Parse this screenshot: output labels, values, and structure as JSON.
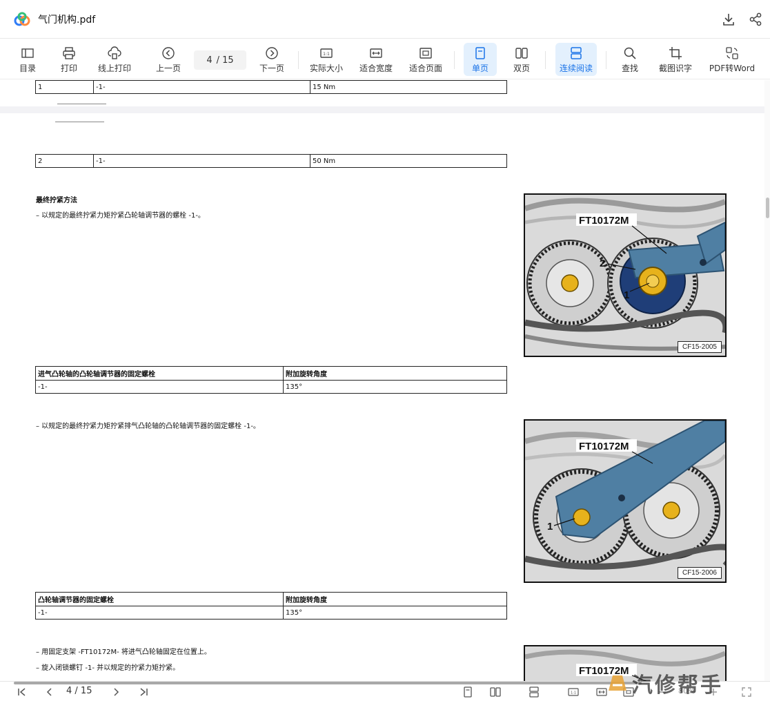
{
  "window": {
    "title": "气门机构.pdf"
  },
  "toolbar": {
    "items": [
      {
        "label": "目录",
        "icon": "toc-icon"
      },
      {
        "label": "打印",
        "icon": "printer-icon"
      },
      {
        "label": "线上打印",
        "icon": "cloud-print-icon"
      },
      {
        "label": "上一页",
        "icon": "prev-page-icon"
      },
      {
        "label": "下一页",
        "icon": "next-page-icon"
      },
      {
        "label": "实际大小",
        "icon": "actual-size-icon"
      },
      {
        "label": "适合宽度",
        "icon": "fit-width-icon"
      },
      {
        "label": "适合页面",
        "icon": "fit-page-icon"
      },
      {
        "label": "单页",
        "icon": "single-page-icon",
        "active": true
      },
      {
        "label": "双页",
        "icon": "two-page-icon"
      },
      {
        "label": "连续阅读",
        "icon": "continuous-icon",
        "active": true
      },
      {
        "label": "查找",
        "icon": "search-icon"
      },
      {
        "label": "截图识字",
        "icon": "crop-ocr-icon"
      },
      {
        "label": "PDF转Word",
        "icon": "pdf-to-word-icon"
      }
    ],
    "page_current": "4",
    "page_total": "/ 15"
  },
  "document": {
    "table1": {
      "col1": "1",
      "col2": "-1-",
      "col3": "15 Nm"
    },
    "table2": {
      "col1": "2",
      "col2": "-1-",
      "col3": "50 Nm"
    },
    "heading_final": "最终拧紧方法",
    "step1": "–    以规定的最终拧紧力矩拧紧凸轮轴调节器的螺栓 -1-。",
    "figure1": {
      "tool_label": "FT10172M",
      "callout_2": "2",
      "callout_1": "1",
      "code": "CF15-2005"
    },
    "table3": {
      "header1": "进气凸轮轴的凸轮轴调节器的固定螺栓",
      "header2": "附加旋转角度",
      "val1": "-1-",
      "val2": "135°"
    },
    "step2": "–    以规定的最终拧紧力矩拧紧排气凸轮轴的凸轮轴调节器的固定螺栓 -1-。",
    "figure2": {
      "tool_label": "FT10172M",
      "callout_1": "1",
      "code": "CF15-2006"
    },
    "table4": {
      "header1": "凸轮轴调节器的固定螺栓",
      "header2": "附加旋转角度",
      "val1": "-1-",
      "val2": "135°"
    },
    "step3": "–    用固定支架 -FT10172M- 将进气凸轮轴固定在位置上。",
    "step4": "–    旋入闭锁螺钉 -1- 并以规定的拧紧力矩拧紧。",
    "figure3": {
      "tool_label": "FT10172M"
    }
  },
  "bottombar": {
    "page_current": "4",
    "page_total": "/ 15",
    "zoom": "80%"
  },
  "watermark": {
    "text": "汽修帮手"
  },
  "colors": {
    "accent": "#1a73e8",
    "active_bg": "#e3f0fd",
    "tool_blue": "#4f7fa3"
  }
}
